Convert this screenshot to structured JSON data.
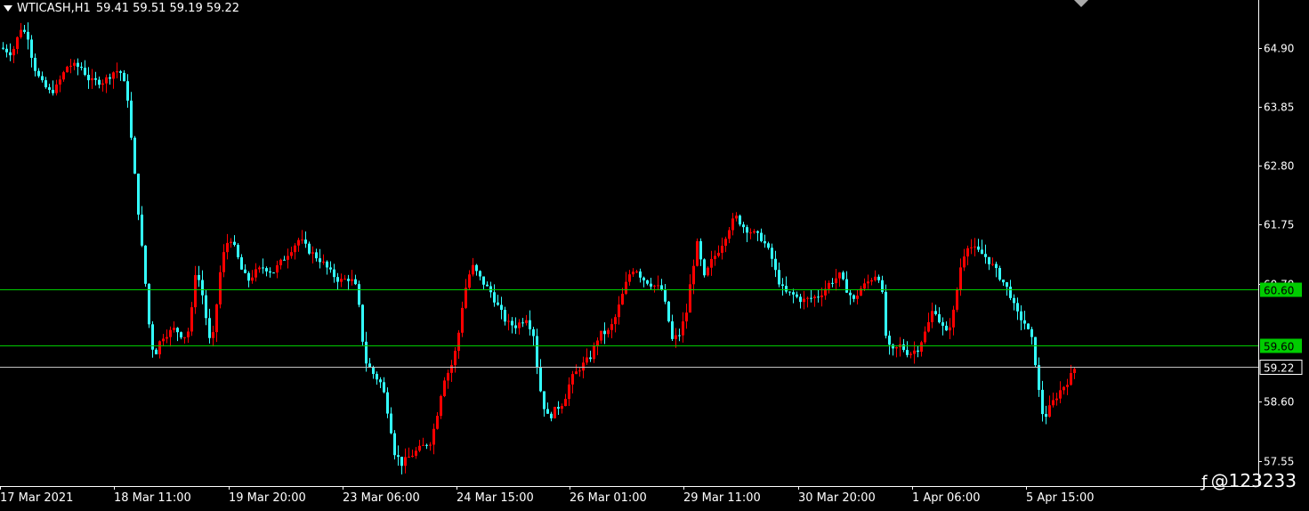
{
  "header": {
    "symbol": "WTICASH,H1",
    "ohlc": "59.41 59.51 59.19 59.22"
  },
  "watermark": "@123233",
  "colors": {
    "background": "#000000",
    "bull": "#ff0000",
    "bear": "#33ffff",
    "level_line": "#00cc00",
    "price_line": "#c0c0c0",
    "axis": "#ffffff"
  },
  "chart_data": {
    "type": "candlestick",
    "symbol": "WTICASH",
    "timeframe": "H1",
    "ylim": [
      57.1,
      65.75
    ],
    "y_ticks": [
      "64.90",
      "63.85",
      "62.80",
      "61.75",
      "60.70",
      "58.60",
      "57.55"
    ],
    "x_labels": [
      "17 Mar 2021",
      "18 Mar 11:00",
      "19 Mar 20:00",
      "23 Mar 06:00",
      "24 Mar 15:00",
      "26 Mar 01:00",
      "29 Mar 11:00",
      "30 Mar 20:00",
      "1 Apr 06:00",
      "5 Apr 15:00"
    ],
    "levels": [
      {
        "value": 60.6,
        "label": "60.60",
        "color": "#00cc00"
      },
      {
        "value": 59.6,
        "label": "59.60",
        "color": "#00cc00"
      }
    ],
    "last_price": {
      "value": 59.22,
      "label": "59.22"
    },
    "price_path": [
      [
        0,
        64.9
      ],
      [
        12,
        64.8
      ],
      [
        22,
        65.25
      ],
      [
        30,
        65.1
      ],
      [
        36,
        64.6
      ],
      [
        44,
        64.3
      ],
      [
        55,
        64.1
      ],
      [
        62,
        64.2
      ],
      [
        75,
        64.6
      ],
      [
        90,
        64.55
      ],
      [
        100,
        64.3
      ],
      [
        115,
        64.3
      ],
      [
        128,
        64.5
      ],
      [
        135,
        64.45
      ],
      [
        142,
        64.0
      ],
      [
        147,
        63.1
      ],
      [
        152,
        62.3
      ],
      [
        157,
        61.5
      ],
      [
        162,
        60.7
      ],
      [
        167,
        59.8
      ],
      [
        172,
        59.4
      ],
      [
        180,
        59.75
      ],
      [
        195,
        59.9
      ],
      [
        205,
        59.75
      ],
      [
        212,
        59.9
      ],
      [
        218,
        60.9
      ],
      [
        224,
        60.7
      ],
      [
        230,
        60.1
      ],
      [
        236,
        59.5
      ],
      [
        241,
        60.2
      ],
      [
        246,
        60.9
      ],
      [
        252,
        61.4
      ],
      [
        258,
        61.5
      ],
      [
        264,
        61.25
      ],
      [
        270,
        60.95
      ],
      [
        277,
        60.75
      ],
      [
        285,
        60.9
      ],
      [
        295,
        61.0
      ],
      [
        305,
        60.9
      ],
      [
        315,
        61.1
      ],
      [
        325,
        61.3
      ],
      [
        335,
        61.5
      ],
      [
        345,
        61.3
      ],
      [
        360,
        61.1
      ],
      [
        370,
        60.9
      ],
      [
        380,
        60.75
      ],
      [
        392,
        60.8
      ],
      [
        400,
        60.6
      ],
      [
        405,
        59.8
      ],
      [
        410,
        59.3
      ],
      [
        418,
        59.1
      ],
      [
        428,
        58.9
      ],
      [
        436,
        58.3
      ],
      [
        442,
        57.7
      ],
      [
        450,
        57.5
      ],
      [
        457,
        57.6
      ],
      [
        465,
        57.7
      ],
      [
        473,
        57.8
      ],
      [
        483,
        57.9
      ],
      [
        490,
        58.4
      ],
      [
        497,
        59.0
      ],
      [
        505,
        59.2
      ],
      [
        512,
        59.6
      ],
      [
        518,
        60.3
      ],
      [
        524,
        60.8
      ],
      [
        530,
        61.0
      ],
      [
        540,
        60.75
      ],
      [
        550,
        60.55
      ],
      [
        558,
        60.3
      ],
      [
        568,
        60.0
      ],
      [
        578,
        59.95
      ],
      [
        590,
        60.1
      ],
      [
        598,
        59.8
      ],
      [
        603,
        59.1
      ],
      [
        608,
        58.6
      ],
      [
        615,
        58.3
      ],
      [
        622,
        58.45
      ],
      [
        632,
        58.6
      ],
      [
        640,
        59.0
      ],
      [
        650,
        59.2
      ],
      [
        662,
        59.4
      ],
      [
        672,
        59.8
      ],
      [
        683,
        59.85
      ],
      [
        690,
        60.1
      ],
      [
        698,
        60.5
      ],
      [
        705,
        60.85
      ],
      [
        712,
        61.0
      ],
      [
        720,
        60.8
      ],
      [
        730,
        60.7
      ],
      [
        742,
        60.6
      ],
      [
        748,
        60.2
      ],
      [
        754,
        59.7
      ],
      [
        762,
        59.8
      ],
      [
        770,
        60.2
      ],
      [
        776,
        60.9
      ],
      [
        782,
        61.4
      ],
      [
        790,
        60.8
      ],
      [
        798,
        61.1
      ],
      [
        808,
        61.35
      ],
      [
        818,
        61.7
      ],
      [
        825,
        61.9
      ],
      [
        835,
        61.7
      ],
      [
        845,
        61.6
      ],
      [
        855,
        61.5
      ],
      [
        865,
        61.2
      ],
      [
        872,
        60.8
      ],
      [
        880,
        60.55
      ],
      [
        890,
        60.5
      ],
      [
        900,
        60.4
      ],
      [
        912,
        60.45
      ],
      [
        920,
        60.5
      ],
      [
        930,
        60.7
      ],
      [
        942,
        60.85
      ],
      [
        950,
        60.6
      ],
      [
        958,
        60.4
      ],
      [
        965,
        60.6
      ],
      [
        975,
        60.75
      ],
      [
        985,
        60.9
      ],
      [
        990,
        60.5
      ],
      [
        995,
        59.6
      ],
      [
        1002,
        59.5
      ],
      [
        1010,
        59.6
      ],
      [
        1020,
        59.45
      ],
      [
        1030,
        59.55
      ],
      [
        1040,
        59.9
      ],
      [
        1048,
        60.3
      ],
      [
        1055,
        60.0
      ],
      [
        1063,
        59.8
      ],
      [
        1070,
        60.2
      ],
      [
        1078,
        61.0
      ],
      [
        1085,
        61.4
      ],
      [
        1095,
        61.3
      ],
      [
        1105,
        61.2
      ],
      [
        1115,
        61.0
      ],
      [
        1125,
        60.75
      ],
      [
        1133,
        60.55
      ],
      [
        1140,
        60.2
      ],
      [
        1150,
        60.0
      ],
      [
        1158,
        59.7
      ],
      [
        1163,
        59.2
      ],
      [
        1168,
        58.5
      ],
      [
        1172,
        58.3
      ],
      [
        1180,
        58.55
      ],
      [
        1190,
        58.8
      ],
      [
        1200,
        59.0
      ],
      [
        1207,
        59.22
      ]
    ]
  }
}
